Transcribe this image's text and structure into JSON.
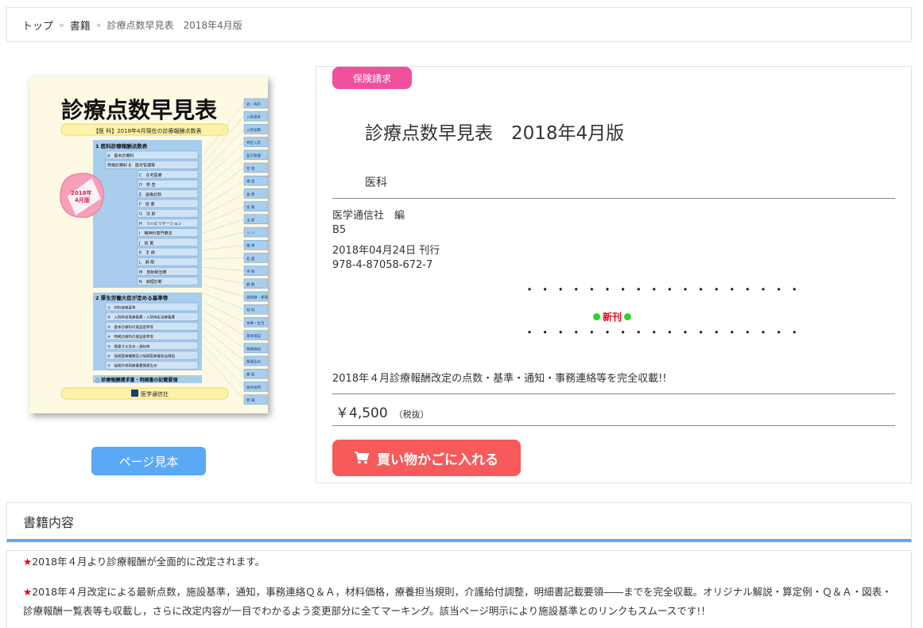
{
  "breadcrumb": {
    "top": "トップ",
    "books": "書籍",
    "separator": "»",
    "current": "診療点数早見表　2018年4月版"
  },
  "cover": {
    "title": "診療点数早見表",
    "edition_label": "【医 科】2018年4月現在の診療報酬点数表",
    "badge_line1": "2018年",
    "badge_line2": "4月版",
    "section1": "1  医科診療報酬点数表",
    "section2": "2  厚生労働大臣が定める基準等",
    "section3": "○ 診療報酬請求書・明細書の記載要領",
    "publisher": "医学通信社",
    "items1": [
      "A　基本診療料",
      "特掲診療料  B　医学管理等",
      "C　在宅医療",
      "D　検 査",
      "E　画像診断",
      "F　投 薬",
      "G　注 射",
      "H　リハビリテーション",
      "I　精神科専門療法",
      "J　処 置",
      "K　手 術",
      "L　麻 酔",
      "M　放射線治療",
      "N　病理診断"
    ],
    "items2": [
      "①　材料価格基準",
      "②　入院時食事療養費・入院時生活療養費",
      "③　基本診療料の施設基準等",
      "④　特掲診療料の施設基準等",
      "⑤　関連する告示・通知等",
      "⑥　保険医療機関及び保険医療養担当規則",
      "⑦　保険外併用療養費関連告示"
    ],
    "tabs": [
      "初・再診",
      "入院基本",
      "入院加算",
      "特定入院",
      "医学管理",
      "在 宅",
      "検 査",
      "画 像",
      "投 薬",
      "注 射",
      "リ ハ",
      "精 神",
      "処 置",
      "手 術",
      "麻 酔",
      "放射線・病理",
      "材 料",
      "食事・生活",
      "基本施設",
      "特掲施設",
      "関連告示",
      "療 担",
      "保外併用",
      "明 細"
    ]
  },
  "sample_button": "ページ見本",
  "badge": "保険請求",
  "title": "診療点数早見表　2018年4月版",
  "subcategory": "医科",
  "meta": {
    "editor": "医学通信社　編",
    "format": "B5",
    "published": "2018年04月24日 刊行",
    "isbn": "978-4-87058-672-7"
  },
  "dots": "・・・・・・・・・・・・・・・・・・",
  "new_label": "新刊",
  "description": "2018年４月診療報酬改定の点数・基準・通知・事務連絡等を完全収載!!",
  "price": {
    "amount": "￥4,500",
    "tax": "（税抜）"
  },
  "cart_button": "買い物かごに入れる",
  "section_title": "書籍内容",
  "content": {
    "star": "★",
    "p1": "2018年４月より診療報酬が全面的に改定されます。",
    "p2": "2018年４月改定による最新点数，施設基準，通知，事務連絡Ｑ＆Ａ，材料価格，療養担当規則，介護給付調整，明細書記載要領――までを完全収載。オリジナル解説・算定例・Ｑ＆Ａ・図表・診療報酬一覧表等も収載し，さらに改定内容が一目でわかるよう変更部分に全てマーキング。該当ページ明示により施設基準とのリンクもスムースです!！"
  },
  "colors": {
    "accent_blue": "#5aa9f5",
    "badge_pink": "#f04f9c",
    "cart_red": "#f65a5a",
    "new_green": "#2bd62b",
    "new_red": "#e60012"
  }
}
